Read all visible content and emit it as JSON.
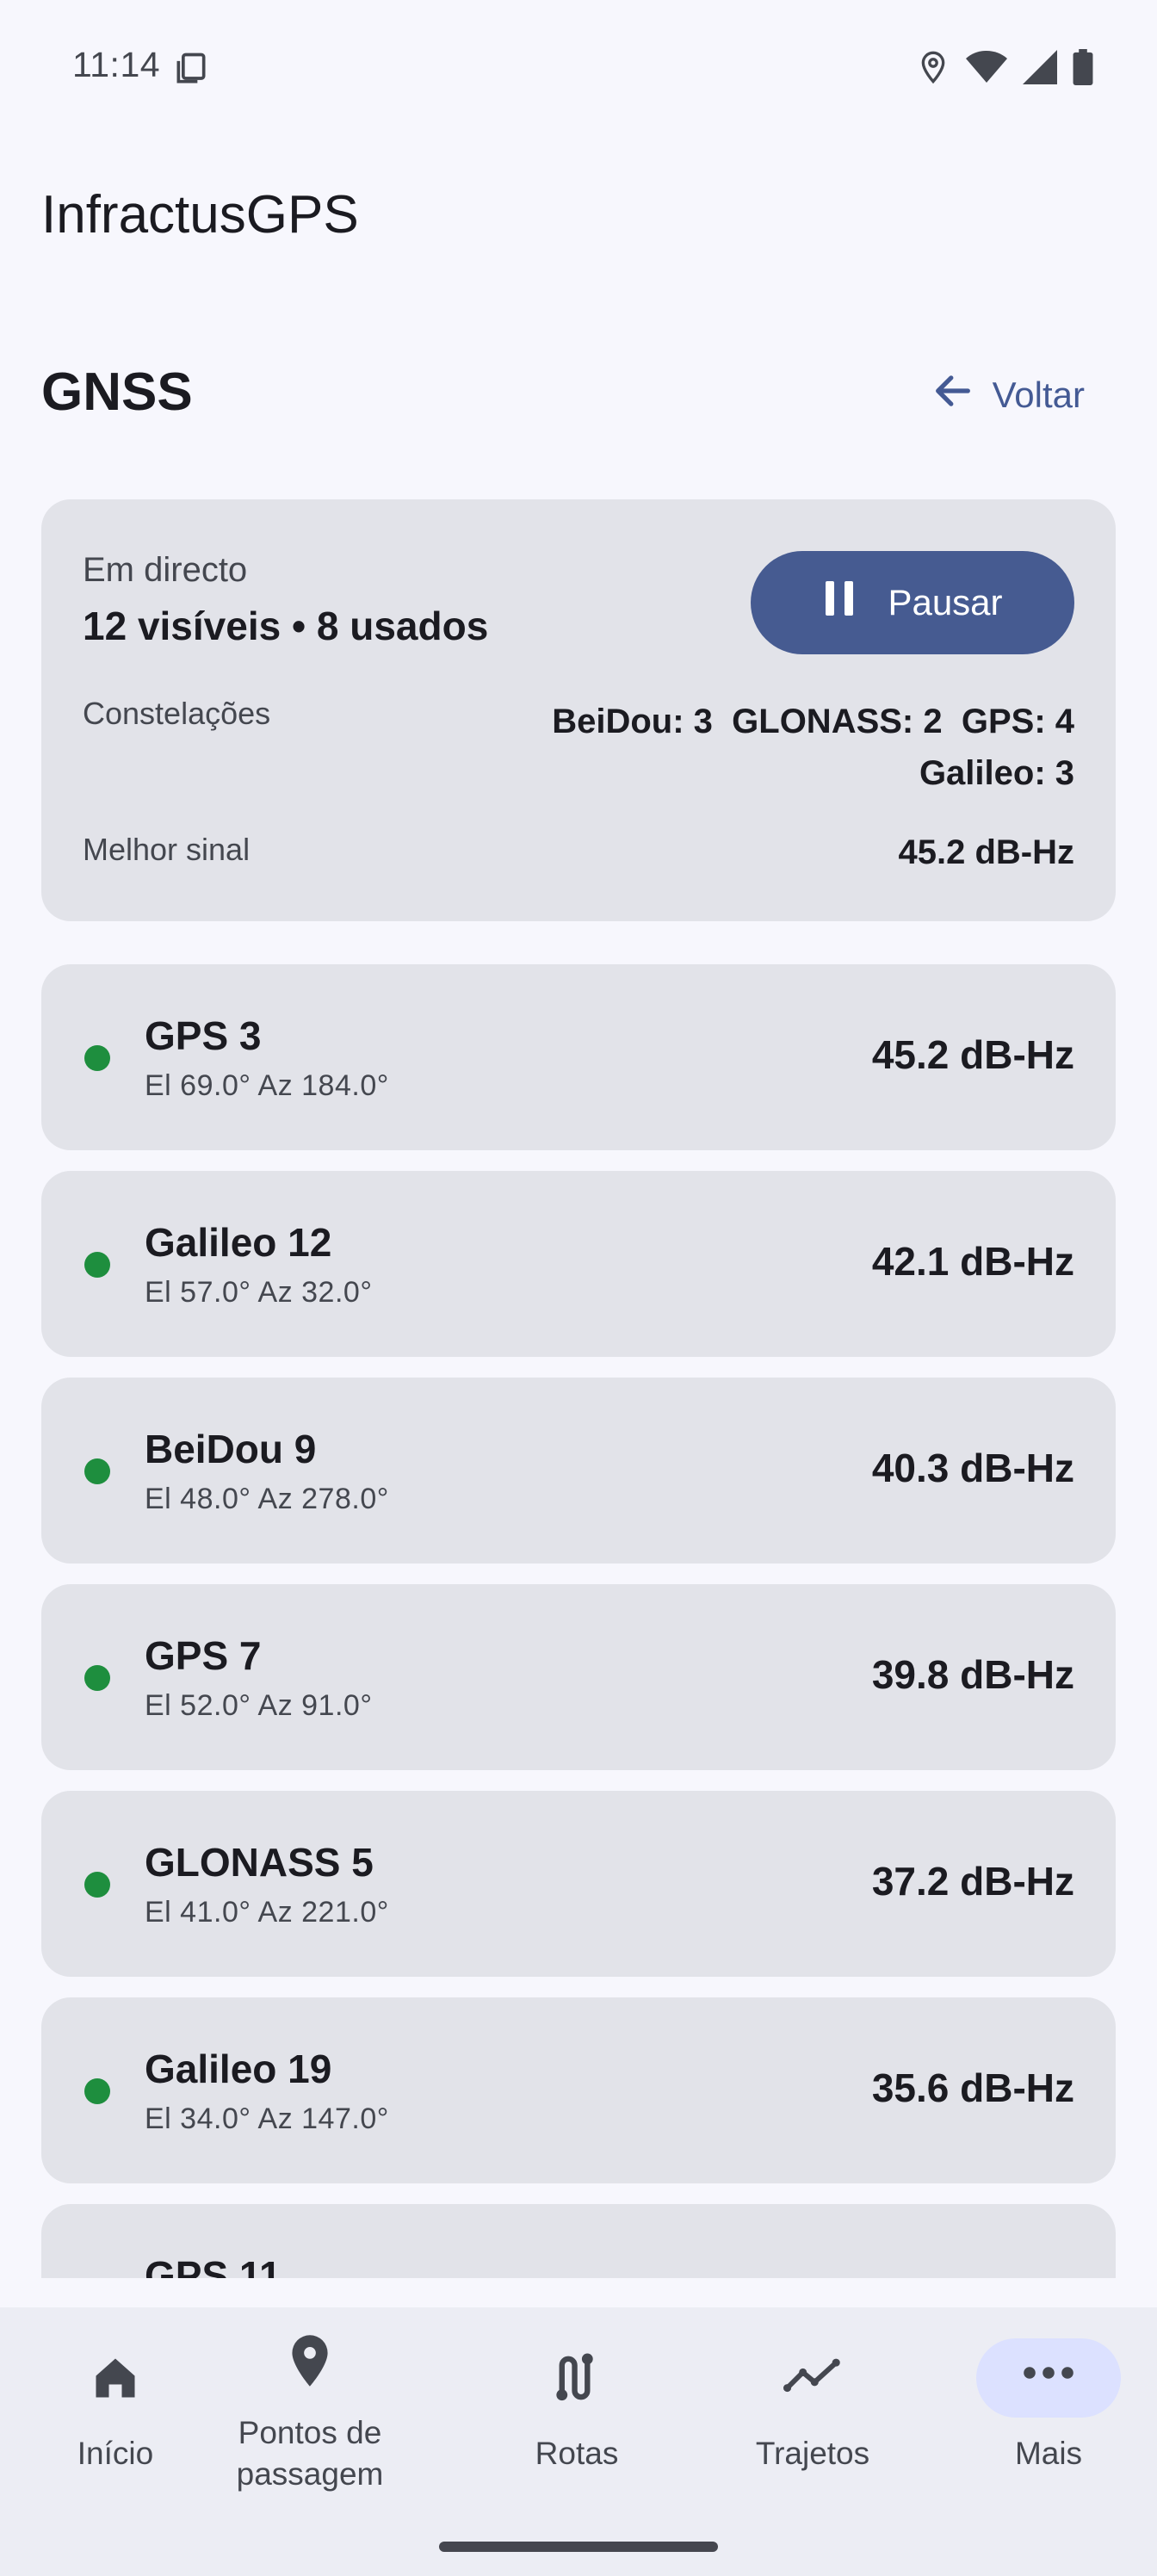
{
  "status_bar": {
    "time": "11:14"
  },
  "app": {
    "title": "InfractusGPS"
  },
  "header": {
    "title": "GNSS",
    "back_label": "Voltar"
  },
  "summary": {
    "live_label": "Em directo",
    "visible_used": "12 visíveis • 8 usados",
    "pause_label": "Pausar",
    "constellations_label": "Constelações",
    "constellations_line1": "BeiDou: 3  GLONASS: 2  GPS: 4",
    "constellations_line2": "Galileo: 3",
    "best_signal_label": "Melhor sinal",
    "best_signal_value": "45.2 dB-Hz"
  },
  "satellites": [
    {
      "name": "GPS 3",
      "position": "El 69.0° Az 184.0°",
      "snr": "45.2 dB-Hz",
      "status_color": "#1E8E3E"
    },
    {
      "name": "Galileo 12",
      "position": "El 57.0° Az 32.0°",
      "snr": "42.1 dB-Hz",
      "status_color": "#1E8E3E"
    },
    {
      "name": "BeiDou 9",
      "position": "El 48.0° Az 278.0°",
      "snr": "40.3 dB-Hz",
      "status_color": "#1E8E3E"
    },
    {
      "name": "GPS 7",
      "position": "El 52.0° Az 91.0°",
      "snr": "39.8 dB-Hz",
      "status_color": "#1E8E3E"
    },
    {
      "name": "GLONASS 5",
      "position": "El 41.0° Az 221.0°",
      "snr": "37.2 dB-Hz",
      "status_color": "#1E8E3E"
    },
    {
      "name": "Galileo 19",
      "position": "El 34.0° Az 147.0°",
      "snr": "35.6 dB-Hz",
      "status_color": "#1E8E3E"
    },
    {
      "name": "GPS 11"
    }
  ],
  "nav": {
    "items": [
      {
        "label": "Início",
        "icon": "home-icon"
      },
      {
        "label": "Pontos de passagem",
        "icon": "location-pin-icon"
      },
      {
        "label": "Rotas",
        "icon": "route-icon"
      },
      {
        "label": "Trajetos",
        "icon": "trend-line-icon"
      },
      {
        "label": "Mais",
        "icon": "more-horizontal-icon",
        "selected": true
      }
    ]
  },
  "colors": {
    "accent": "#465B91",
    "background": "#F7F7FD",
    "card": "#E2E3E9",
    "status_dot": "#1E8E3E",
    "nav_selected_pill": "#DCE1FF"
  }
}
